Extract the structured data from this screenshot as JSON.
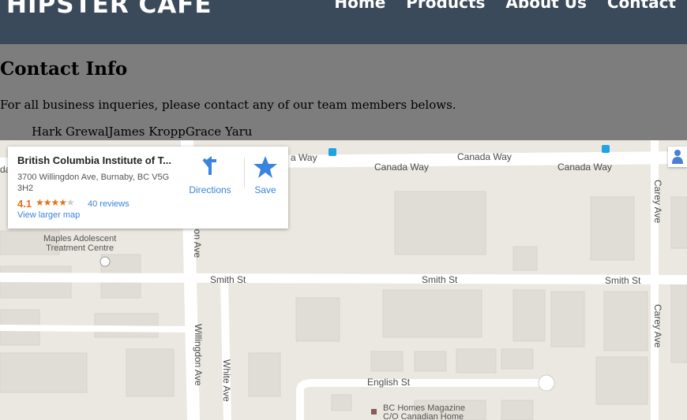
{
  "header": {
    "logo": "HIPSTER CAFE",
    "nav": [
      "Home",
      "Products",
      "About Us",
      "Contact"
    ]
  },
  "content": {
    "title": "Contact Info",
    "intro": "For all business inqueries, please contact any of our team members belows.",
    "team": [
      "Hark Grewal",
      "James Kropp",
      "Grace Yaru"
    ]
  },
  "map": {
    "card": {
      "title": "British Columbia Institute of T...",
      "address": "3700 Willingdon Ave, Burnaby, BC V5G 3H2",
      "rating": "4.1",
      "stars": "★★★★",
      "stars_off": "★",
      "reviews": "40 reviews",
      "view_larger": "View larger map",
      "directions": "Directions",
      "save": "Save"
    },
    "streets": {
      "canada_way_1": "a Way",
      "canada_way_2": "Canada Way",
      "canada_way_3": "Canada Way",
      "canada_way_4": "Canada Way",
      "carey_1": "Carey Ave",
      "carey_2": "Carey Ave",
      "smith_1": "Smith St",
      "smith_2": "Smith St",
      "smith_3": "Smith St",
      "willingdon_1": "lon Ave",
      "willingdon_2": "Willingdon Ave",
      "white": "White Ave",
      "english": "English St",
      "da": "da"
    },
    "places": {
      "maples": "Maples Adolescent\nTreatment Centre",
      "bchomes": "BC Homes Magazine",
      "bchomes2": "C/O Canadian Home"
    },
    "colors": {
      "map_bg": "#ebe8e2",
      "road": "#ffffff",
      "building": "#e0ddd6",
      "accent_link": "#3a84df",
      "rating": "#e7711b"
    }
  }
}
